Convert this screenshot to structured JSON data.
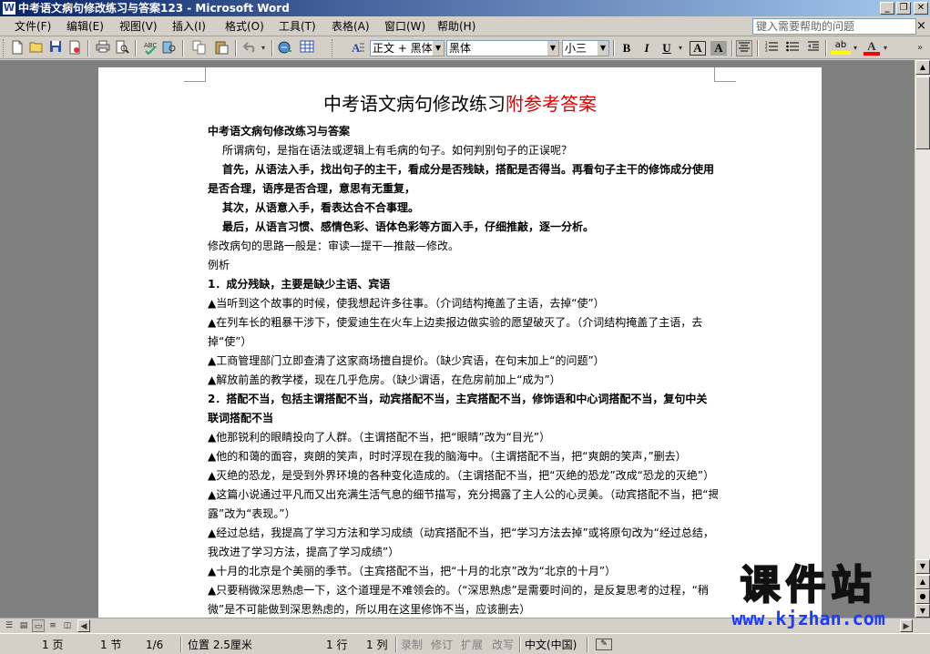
{
  "window": {
    "title": "中考语文病句修改练习与答案123 - Microsoft Word",
    "app_icon_glyph": "W",
    "controls": [
      "_",
      "❐",
      "✕"
    ]
  },
  "menubar": {
    "items": [
      "文件(F)",
      "编辑(E)",
      "视图(V)",
      "插入(I)",
      "格式(O)",
      "工具(T)",
      "表格(A)",
      "窗口(W)",
      "帮助(H)"
    ],
    "help_placeholder": "键入需要帮助的问题",
    "help_close": "×"
  },
  "toolbar": {
    "style": "正文 + 黑体",
    "font": "黑体",
    "size": "小三",
    "bold": "B",
    "italic": "I",
    "underline": "U",
    "char_border": "A",
    "char_shading": "A",
    "highlight_glyph": "ab",
    "font_color_glyph": "A",
    "highlight_color": "#ffff00",
    "font_color": "#ff0000"
  },
  "document": {
    "title_black": "中考语文病句修改练习",
    "title_red": "附参考答案",
    "title_red_color": "#e00000",
    "lines": [
      {
        "text": "中考语文病句修改练习与答案",
        "style": "b"
      },
      {
        "text": "所谓病句，是指在语法或逻辑上有毛病的句子。如何判别句子的正误呢？",
        "style": "ind"
      },
      {
        "text": "首先，从语法入手，找出句子的主干，看成分是否残缺，搭配是否得当。再看句子主干的修饰成分使用",
        "style": "b ind"
      },
      {
        "text": "是否合理，语序是否合理，意思有无重复，",
        "style": "b"
      },
      {
        "text": "其次，从语意入手，看表达合不合事理。",
        "style": "b ind"
      },
      {
        "text": "最后，从语言习惯、感情色彩、语体色彩等方面入手，仔细推敲，逐一分析。",
        "style": "b ind"
      },
      {
        "text": "修改病句的思路一般是：审读—提干—推敲—修改。",
        "style": ""
      },
      {
        "text": "例析",
        "style": ""
      },
      {
        "text": "1．成分残缺，主要是缺少主语、宾语",
        "style": "b"
      },
      {
        "text": "▲当听到这个故事的时候，使我想起许多往事。（介词结构掩盖了主语，去掉“使”）",
        "style": ""
      },
      {
        "text": "▲在列车长的粗暴干涉下，使爱迪生在火车上边卖报边做实验的愿望破灭了。（介词结构掩盖了主语，去",
        "style": ""
      },
      {
        "text": "掉“使”）",
        "style": ""
      },
      {
        "text": "▲工商管理部门立即查清了这家商场擅自提价。（缺少宾语，在句末加上“的问题”）",
        "style": ""
      },
      {
        "text": "▲解放前盖的教学楼，现在几乎危房。（缺少谓语，在危房前加上“成为”）",
        "style": ""
      },
      {
        "text": "2．搭配不当，包括主谓搭配不当，动宾搭配不当，主宾搭配不当，修饰语和中心词搭配不当，复句中关",
        "style": "b"
      },
      {
        "text": "联词搭配不当",
        "style": "b"
      },
      {
        "text": "▲他那锐利的眼睛投向了人群。（主谓搭配不当，把“眼睛”改为“目光”）",
        "style": ""
      },
      {
        "text": "▲他的和蔼的面容，爽朗的笑声，时时浮现在我的脑海中。（主谓搭配不当，把“爽朗的笑声，”删去）",
        "style": ""
      },
      {
        "text": "▲灭绝的恐龙，是受到外界环境的各种变化造成的。（主谓搭配不当，把“灭绝的恐龙”改成“恐龙的灭绝”）",
        "style": ""
      },
      {
        "text": "▲这篇小说通过平凡而又出充满生活气息的细节描写，充分揭露了主人公的心灵美。（动宾搭配不当，把“揭",
        "style": ""
      },
      {
        "text": "露”改为“表现。”）",
        "style": ""
      },
      {
        "text": "▲经过总结，我提高了学习方法和学习成绩（动宾搭配不当，把“学习方法去掉”或将原句改为“经过总结，",
        "style": ""
      },
      {
        "text": "我改进了学习方法，提高了学习成绩”）",
        "style": ""
      },
      {
        "text": "▲十月的北京是个美丽的季节。（主宾搭配不当，把“十月的北京”改为“北京的十月”）",
        "style": ""
      },
      {
        "text": "▲只要稍微深思熟虑一下，这个道理是不难领会的。（“深思熟虑”是需要时间的，是反复思考的过程，“稍",
        "style": ""
      },
      {
        "text": "微”是不可能做到深思熟虑的，所以用在这里修饰不当，应该删去）",
        "style": ""
      }
    ]
  },
  "statusbar": {
    "page": "1 页",
    "section": "1 节",
    "pages": "1/6",
    "position": "位置 2.5厘米",
    "line": "1 行",
    "column": "1 列",
    "rec": "录制",
    "trk": "修订",
    "ext": "扩展",
    "ovr": "改写",
    "language": "中文(中国)"
  },
  "watermark": {
    "title": "课件站",
    "url": "www.kjzhan.com"
  },
  "icons": [
    "new-doc-icon",
    "open-folder-icon",
    "save-icon",
    "permission-icon",
    "print-icon",
    "print-preview-icon",
    "spelling-icon",
    "research-icon",
    "copy-icon",
    "paste-icon",
    "undo-icon",
    "hyperlink-icon",
    "table-icon",
    "styles-icon",
    "align-center-icon",
    "numbering-icon",
    "bullets-icon",
    "decrease-indent-icon"
  ]
}
